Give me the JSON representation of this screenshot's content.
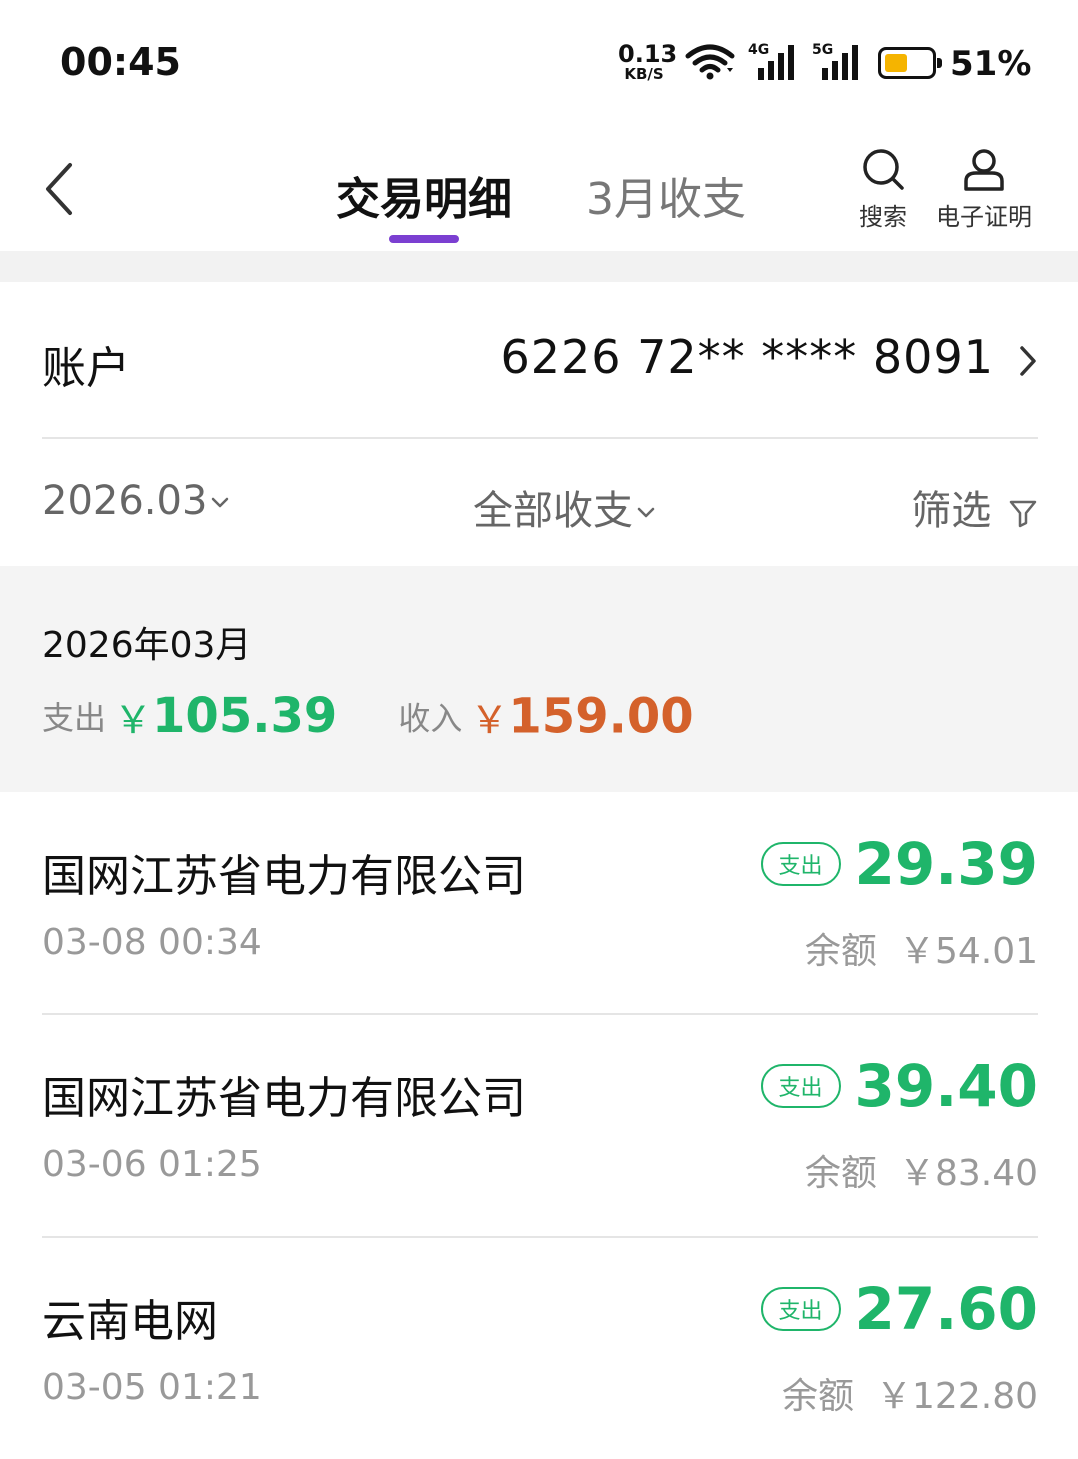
{
  "status_bar": {
    "time": "00:45",
    "net_speed_value": "0.13",
    "net_speed_unit": "KB/S",
    "signal_1_label": "4G",
    "signal_2_label": "5G",
    "battery_percent": "51%",
    "battery_level": 0.51,
    "battery_color": "#f5b400"
  },
  "header": {
    "tabs": [
      {
        "label": "交易明细",
        "active": true
      },
      {
        "label": "3月收支",
        "active": false
      }
    ],
    "search_label": "搜索",
    "certificate_label": "电子证明",
    "accent_color": "#7b3fd1"
  },
  "account": {
    "label": "账户",
    "number": "6226 72** **** 8091"
  },
  "filters": {
    "date": "2026.03",
    "type": "全部收支",
    "screen": "筛选"
  },
  "summary": {
    "month": "2026年03月",
    "expense_label": "支出",
    "expense_currency": "￥",
    "expense_value": "105.39",
    "income_label": "收入",
    "income_currency": "￥",
    "income_value": "159.00",
    "expense_color": "#1fb56a",
    "income_color": "#d4612b"
  },
  "transactions": [
    {
      "name": "国网江苏省电力有限公司",
      "time": "03-08 00:34",
      "badge": "支出",
      "amount": "29.39",
      "balance_label": "余额",
      "balance": "￥54.01"
    },
    {
      "name": "国网江苏省电力有限公司",
      "time": "03-06 01:25",
      "badge": "支出",
      "amount": "39.40",
      "balance_label": "余额",
      "balance": "￥83.40"
    },
    {
      "name": "云南电网",
      "time": "03-05 01:21",
      "badge": "支出",
      "amount": "27.60",
      "balance_label": "余额",
      "balance": "￥122.80"
    }
  ]
}
